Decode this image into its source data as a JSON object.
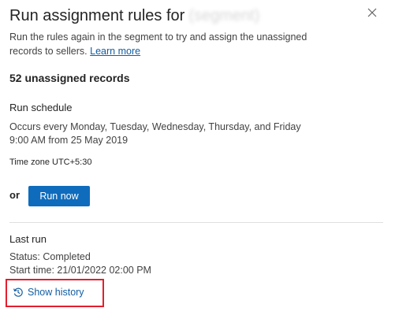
{
  "panel": {
    "title": "Run assignment rules for",
    "title_redacted": "(segment)",
    "close_icon": "close-icon",
    "description": "Run the rules again in the segment to try and assign the unassigned records to sellers.",
    "learn_more_label": "Learn more"
  },
  "records": {
    "count_label": "52 unassigned records"
  },
  "schedule": {
    "heading": "Run schedule",
    "line1": "Occurs every Monday, Tuesday, Wednesday, Thursday, and Friday",
    "line2": "9:00 AM from 25 May 2019",
    "timezone": "Time zone UTC+5:30"
  },
  "run_now": {
    "or_label": "or",
    "button_label": "Run now"
  },
  "last_run": {
    "heading": "Last run",
    "status": "Status: Completed",
    "start_time": "Start time: 21/01/2022  02:00 PM",
    "history_label": "Show history",
    "history_icon": "history-icon"
  },
  "colors": {
    "accent": "#0f6cbd",
    "link": "#115ea3",
    "highlight_border": "#e31e2d"
  }
}
